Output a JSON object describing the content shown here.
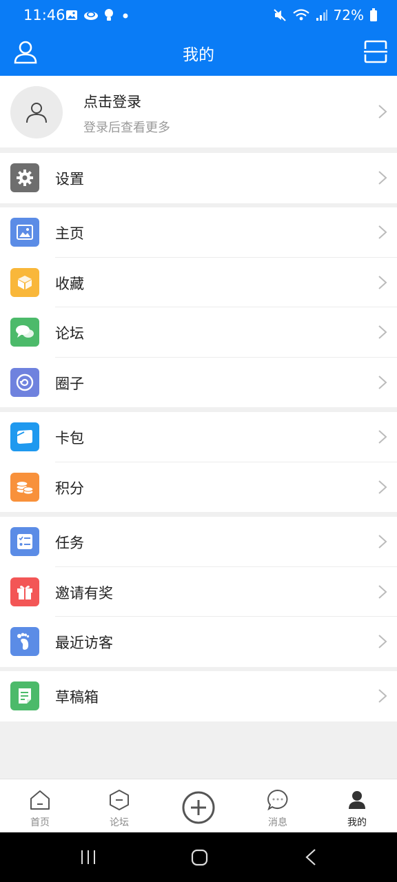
{
  "status": {
    "time": "11:46",
    "battery": "72%"
  },
  "header": {
    "title": "我的"
  },
  "profile": {
    "title": "点击登录",
    "subtitle": "登录后查看更多"
  },
  "colors": {
    "primary": "#0a7cf6"
  },
  "groups": [
    [
      {
        "label": "设置",
        "icon": "gear-icon",
        "color": "#6e6e6e"
      }
    ],
    [
      {
        "label": "主页",
        "icon": "image-icon",
        "color": "#5b8ce6"
      },
      {
        "label": "收藏",
        "icon": "box-icon",
        "color": "#f9b73a"
      },
      {
        "label": "论坛",
        "icon": "chat-icon",
        "color": "#4cba6a"
      },
      {
        "label": "圈子",
        "icon": "circle-icon",
        "color": "#6f82de"
      }
    ],
    [
      {
        "label": "卡包",
        "icon": "card-icon",
        "color": "#1f99ef"
      },
      {
        "label": "积分",
        "icon": "coins-icon",
        "color": "#f8913b"
      }
    ],
    [
      {
        "label": "任务",
        "icon": "checklist-icon",
        "color": "#5b8ce6"
      },
      {
        "label": "邀请有奖",
        "icon": "gift-icon",
        "color": "#f35656"
      },
      {
        "label": "最近访客",
        "icon": "footprint-icon",
        "color": "#5b8ce6"
      }
    ],
    [
      {
        "label": "草稿箱",
        "icon": "document-icon",
        "color": "#4cba6a"
      }
    ]
  ],
  "bottom_nav": [
    {
      "label": "首页",
      "icon": "home-icon"
    },
    {
      "label": "论坛",
      "icon": "forum-icon"
    },
    {
      "label": "",
      "icon": "plus-icon"
    },
    {
      "label": "消息",
      "icon": "message-icon"
    },
    {
      "label": "我的",
      "icon": "profile-icon",
      "active": true
    }
  ]
}
